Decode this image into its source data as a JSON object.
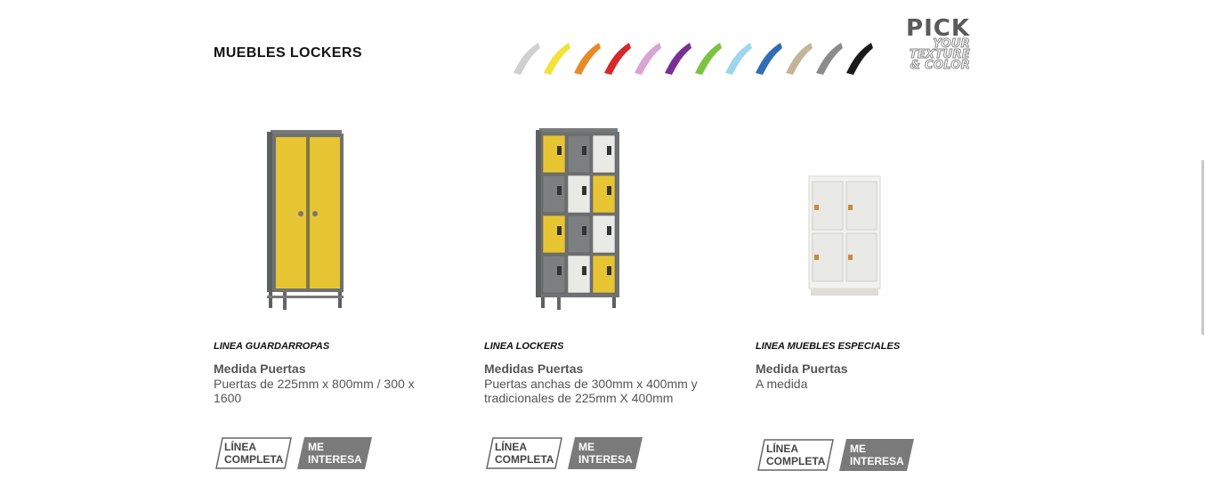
{
  "header": {
    "title": "MUEBLES LOCKERS",
    "pick_logo": {
      "line1": "PICK",
      "line2": "YOUR",
      "line3": "TEXTURE",
      "line4": "& COLOR"
    },
    "swatch_colors": [
      "#d0d0d0",
      "#f2e23a",
      "#e98a2a",
      "#d8282a",
      "#d9a3d3",
      "#7a2f96",
      "#7dc242",
      "#9ed6ec",
      "#2f6db5",
      "#c4b49a",
      "#8c8c8c",
      "#1a1a1a"
    ]
  },
  "products": [
    {
      "image_icon": "locker-guardarropas-icon",
      "line": "LINEA GUARDARROPAS",
      "spec_title": "Medida Puertas",
      "spec_text": "Puertas de 225mm x 800mm / 300 x 1600",
      "btn_completa": "LÍNEA COMPLETA",
      "btn_interesa": "ME INTERESA"
    },
    {
      "image_icon": "locker-multidoor-icon",
      "line": "LINEA LOCKERS",
      "spec_title": "Medidas Puertas",
      "spec_text": "Puertas anchas de 300mm x 400mm y tradicionales de 225mm X 400mm",
      "btn_completa": "LÍNEA COMPLETA",
      "btn_interesa": "ME INTERESA"
    },
    {
      "image_icon": "locker-especial-icon",
      "line": "LINEA MUEBLES ESPECIALES",
      "spec_title": "Medida Puertas",
      "spec_text": "A medida",
      "btn_completa": "LÍNEA COMPLETA",
      "btn_interesa": "ME INTERESA"
    }
  ],
  "colors": {
    "locker_gray": "#6f7272",
    "locker_yellow": "#e7c532",
    "locker_white": "#e9e9e6",
    "button_gray": "#7a7a7a"
  }
}
